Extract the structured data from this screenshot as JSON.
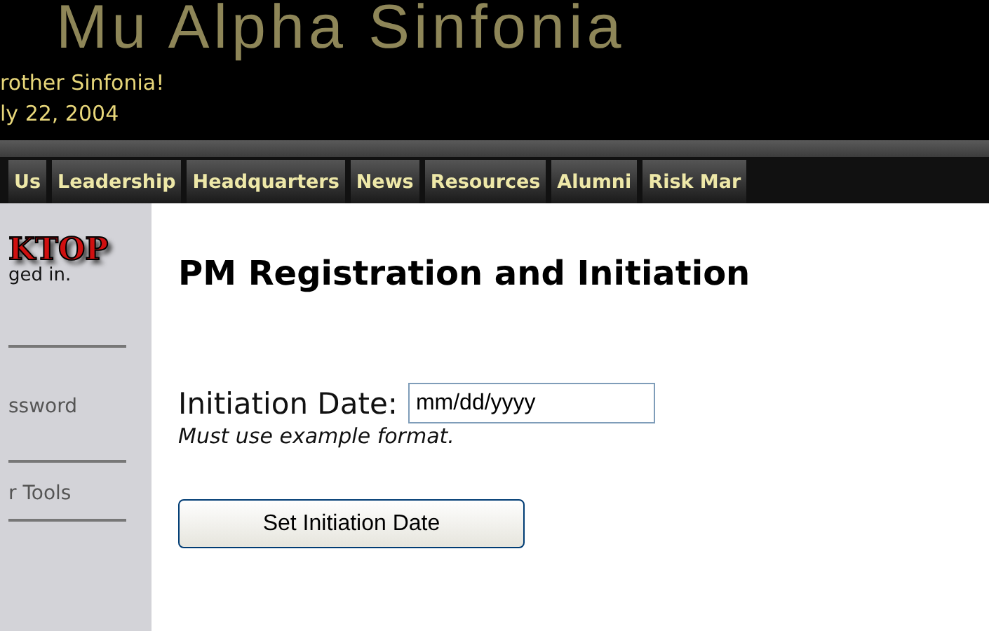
{
  "banner": {
    "title": "Mu Alpha Sinfonia",
    "greeting": "rother Sinfonia!",
    "date": "ly 22, 2004"
  },
  "nav": {
    "tabs": [
      "Us",
      "Leadership",
      "Headquarters",
      "News",
      "Resources",
      "Alumni",
      "Risk Mar"
    ]
  },
  "sidebar": {
    "logo": "KTOP",
    "status": "ged in.",
    "links": [
      "ssword",
      "r Tools"
    ]
  },
  "main": {
    "heading": "PM Registration and Initiation",
    "field": {
      "label": "Initiation Date:",
      "value": "mm/dd/yyyy",
      "hint": "Must use example format."
    },
    "button": "Set Initiation Date"
  }
}
